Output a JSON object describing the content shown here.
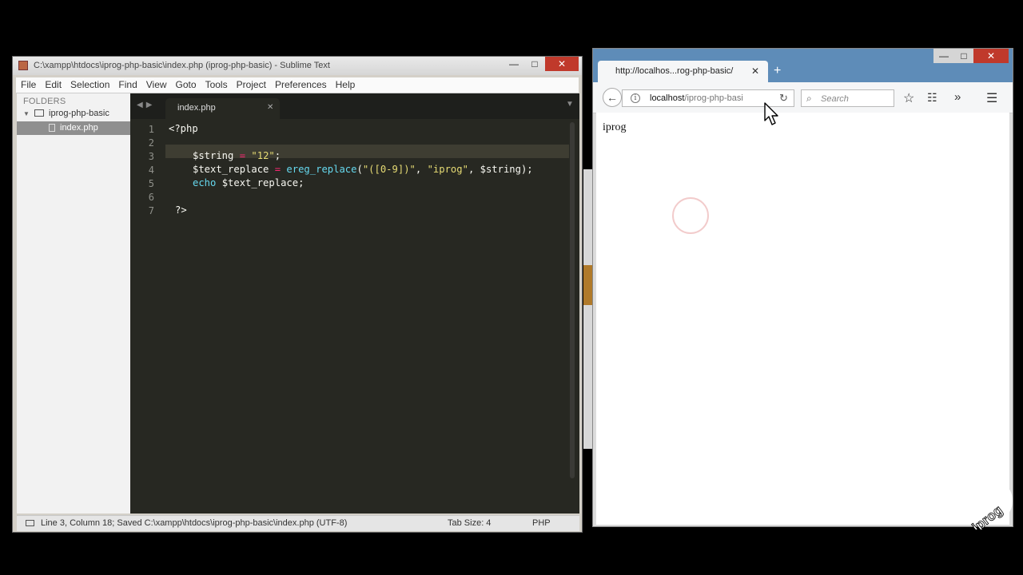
{
  "sublime": {
    "title": "C:\\xampp\\htdocs\\iprog-php-basic\\index.php (iprog-php-basic) - Sublime Text",
    "menu": [
      "File",
      "Edit",
      "Selection",
      "Find",
      "View",
      "Goto",
      "Tools",
      "Project",
      "Preferences",
      "Help"
    ],
    "sidebar": {
      "header": "FOLDERS",
      "folder": "iprog-php-basic",
      "file": "index.php"
    },
    "tab": {
      "label": "index.php"
    },
    "line_numbers": [
      "1",
      "2",
      "3",
      "4",
      "5",
      "6",
      "7"
    ],
    "code": {
      "l1": "<?php",
      "l3_var": "$string",
      "l3_op": "=",
      "l3_str": "\"12\"",
      "l3_end": ";",
      "l4_var": "$text_replace",
      "l4_op": "=",
      "l4_fn": "ereg_replace",
      "l4_open": "(",
      "l4_arg1": "\"([0-9])\"",
      "l4_comma1": ", ",
      "l4_arg2": "\"iprog\"",
      "l4_rest": ", $string);",
      "l5_kw": "echo",
      "l5_rest": " $text_replace;",
      "l7": "?>"
    },
    "status": {
      "left": "Line 3, Column 18; Saved C:\\xampp\\htdocs\\iprog-php-basic\\index.php (UTF-8)",
      "tab_size": "Tab Size: 4",
      "syntax": "PHP"
    }
  },
  "firefox": {
    "tab_title": "http://localhos...rog-php-basic/",
    "url_host": "localhost",
    "url_path": "/iprog-php-basi",
    "search_placeholder": "Search",
    "page_text": "iprog"
  },
  "watermark": {
    "text": "iprog"
  },
  "colors": {
    "editor_bg": "#272822",
    "string": "#e6db74",
    "operator": "#f92672",
    "function": "#66d9ef",
    "firefox_accent": "#5e8cb8"
  }
}
